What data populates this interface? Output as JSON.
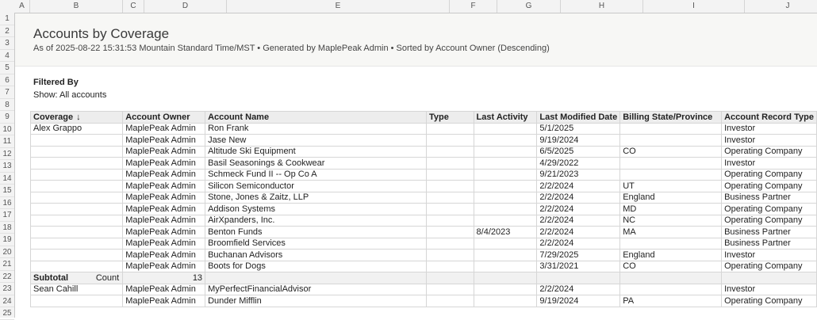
{
  "columns": [
    "A",
    "B",
    "C",
    "D",
    "E",
    "F",
    "G",
    "H",
    "I",
    "J"
  ],
  "row_numbers": [
    "1",
    "2",
    "3",
    "4",
    "5",
    "6",
    "7",
    "8",
    "9",
    "10",
    "11",
    "12",
    "13",
    "14",
    "15",
    "16",
    "17",
    "18",
    "19",
    "20",
    "21",
    "22",
    "23",
    "24",
    "25"
  ],
  "report": {
    "title": "Accounts by Coverage",
    "subtitle": "As of 2025-08-22 15:31:53 Mountain Standard Time/MST • Generated by MaplePeak Admin • Sorted by Account Owner (Descending)",
    "filtered_by": "Filtered By",
    "show": "Show: All accounts"
  },
  "table": {
    "headers": {
      "coverage": "Coverage",
      "sort_icon": "↓",
      "owner": "Account Owner",
      "name": "Account Name",
      "type": "Type",
      "last_activity": "Last Activity",
      "last_modified": "Last Modified Date",
      "billing_state": "Billing State/Province",
      "record_type": "Account Record Type"
    },
    "groups": [
      {
        "coverage": "Alex Grappo",
        "rows": [
          {
            "owner": "MaplePeak Admin",
            "name": "Ron Frank",
            "type": "",
            "last_activity": "",
            "last_modified": "5/1/2025",
            "billing_state": "",
            "record_type": "Investor"
          },
          {
            "owner": "MaplePeak Admin",
            "name": "Jase New",
            "type": "",
            "last_activity": "",
            "last_modified": "9/19/2024",
            "billing_state": "",
            "record_type": "Investor"
          },
          {
            "owner": "MaplePeak Admin",
            "name": "Altitude Ski Equipment",
            "type": "",
            "last_activity": "",
            "last_modified": "6/5/2025",
            "billing_state": "CO",
            "record_type": "Operating Company"
          },
          {
            "owner": "MaplePeak Admin",
            "name": "Basil Seasonings & Cookwear",
            "type": "",
            "last_activity": "",
            "last_modified": "4/29/2022",
            "billing_state": "",
            "record_type": "Investor"
          },
          {
            "owner": "MaplePeak Admin",
            "name": "Schmeck Fund II -- Op Co A",
            "type": "",
            "last_activity": "",
            "last_modified": "9/21/2023",
            "billing_state": "",
            "record_type": "Operating Company"
          },
          {
            "owner": "MaplePeak Admin",
            "name": "Silicon Semiconductor",
            "type": "",
            "last_activity": "",
            "last_modified": "2/2/2024",
            "billing_state": "UT",
            "record_type": "Operating Company"
          },
          {
            "owner": "MaplePeak Admin",
            "name": "Stone, Jones & Zaitz, LLP",
            "type": "",
            "last_activity": "",
            "last_modified": "2/2/2024",
            "billing_state": "England",
            "record_type": "Business Partner"
          },
          {
            "owner": "MaplePeak Admin",
            "name": "Addison Systems",
            "type": "",
            "last_activity": "",
            "last_modified": "2/2/2024",
            "billing_state": "MD",
            "record_type": "Operating Company"
          },
          {
            "owner": "MaplePeak Admin",
            "name": "AirXpanders, Inc.",
            "type": "",
            "last_activity": "",
            "last_modified": "2/2/2024",
            "billing_state": "NC",
            "record_type": "Operating Company"
          },
          {
            "owner": "MaplePeak Admin",
            "name": "Benton Funds",
            "type": "",
            "last_activity": "8/4/2023",
            "last_modified": "2/2/2024",
            "billing_state": "MA",
            "record_type": "Business Partner"
          },
          {
            "owner": "MaplePeak Admin",
            "name": "Broomfield Services",
            "type": "",
            "last_activity": "",
            "last_modified": "2/2/2024",
            "billing_state": "",
            "record_type": "Business Partner"
          },
          {
            "owner": "MaplePeak Admin",
            "name": "Buchanan Advisors",
            "type": "",
            "last_activity": "",
            "last_modified": "7/29/2025",
            "billing_state": "England",
            "record_type": "Investor"
          },
          {
            "owner": "MaplePeak Admin",
            "name": "Boots for Dogs",
            "type": "",
            "last_activity": "",
            "last_modified": "3/31/2021",
            "billing_state": "CO",
            "record_type": "Operating Company"
          }
        ],
        "subtotal_label": "Subtotal",
        "count_label": "Count",
        "count": "13"
      },
      {
        "coverage": "Sean Cahill",
        "rows": [
          {
            "owner": "MaplePeak Admin",
            "name": "MyPerfectFinancialAdvisor",
            "type": "",
            "last_activity": "",
            "last_modified": "2/2/2024",
            "billing_state": "",
            "record_type": "Investor"
          },
          {
            "owner": "MaplePeak Admin",
            "name": "Dunder Mifflin",
            "type": "",
            "last_activity": "",
            "last_modified": "9/19/2024",
            "billing_state": "PA",
            "record_type": "Operating Company"
          }
        ]
      }
    ]
  }
}
